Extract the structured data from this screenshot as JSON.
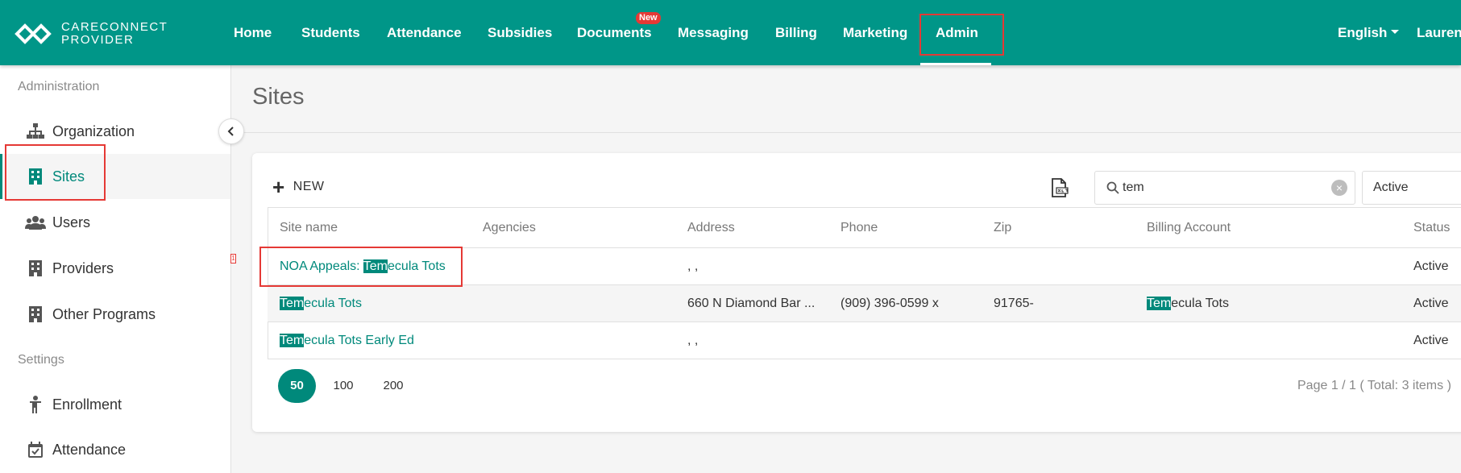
{
  "brand": {
    "line1": "CARECONNECT",
    "line2": "PROVIDER"
  },
  "nav": {
    "items": [
      "Home",
      "Students",
      "Attendance",
      "Subsidies",
      "Documents",
      "Messaging",
      "Billing",
      "Marketing",
      "Admin"
    ],
    "documents_badge": "New",
    "active": "Admin",
    "language": "English",
    "user": "Lauren"
  },
  "sidebar": {
    "section_admin": "Administration",
    "admin_items": [
      "Organization",
      "Sites",
      "Users",
      "Providers",
      "Other Programs"
    ],
    "section_settings": "Settings",
    "settings_items": [
      "Enrollment",
      "Attendance"
    ],
    "active": "Sites",
    "tiny_marker": "1"
  },
  "page": {
    "title": "Sites"
  },
  "toolbar": {
    "new_label": "NEW",
    "search_value": "tem",
    "search_placeholder": "Search",
    "status_value": "Active"
  },
  "table": {
    "columns": [
      "Site name",
      "Agencies",
      "Address",
      "Phone",
      "Zip",
      "Billing Account",
      "Status"
    ],
    "rows": [
      {
        "site_pre": "NOA Appeals: ",
        "site_hl": "Tem",
        "site_post": "ecula Tots",
        "agencies": "",
        "address": ", ,",
        "phone": "",
        "zip": "",
        "billing_hl": "",
        "billing_post": "",
        "status": "Active"
      },
      {
        "site_pre": "",
        "site_hl": "Tem",
        "site_post": "ecula Tots",
        "agencies": "",
        "address": "660 N Diamond Bar ...",
        "phone": "(909) 396-0599 x",
        "zip": "91765-",
        "billing_hl": "Tem",
        "billing_post": "ecula Tots",
        "status": "Active"
      },
      {
        "site_pre": "",
        "site_hl": "Tem",
        "site_post": "ecula Tots Early Ed",
        "agencies": "",
        "address": ", ,",
        "phone": "",
        "zip": "",
        "billing_hl": "",
        "billing_post": "",
        "status": "Active"
      }
    ]
  },
  "pagination": {
    "sizes": [
      "50",
      "100",
      "200"
    ],
    "active_size": "50",
    "info": "Page 1 / 1 ( Total: 3 items )"
  },
  "colors": {
    "primary": "#009688",
    "accent": "#00897b",
    "highlight_box": "#e53935"
  }
}
